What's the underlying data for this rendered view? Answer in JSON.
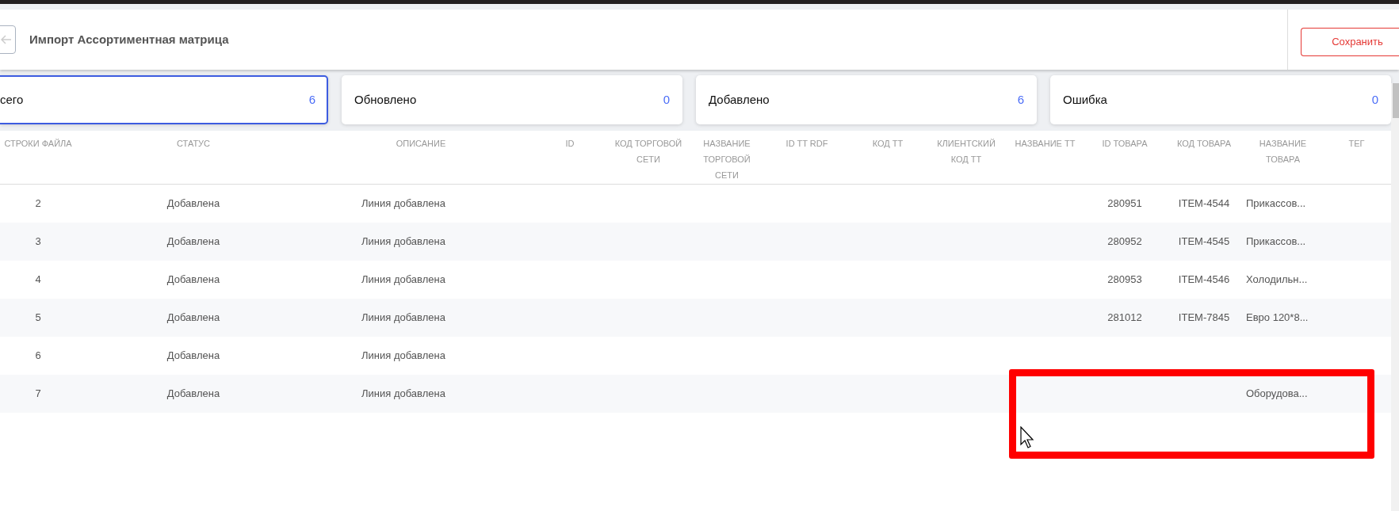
{
  "page": {
    "title": "Импорт Ассортиментная матрица"
  },
  "save_button": "Сохранить",
  "summary_cards": [
    {
      "label": "сего",
      "count": "6",
      "selected": true
    },
    {
      "label": "Обновлено",
      "count": "0",
      "selected": false
    },
    {
      "label": "Добавлено",
      "count": "6",
      "selected": false
    },
    {
      "label": "Ошибка",
      "count": "0",
      "selected": false
    }
  ],
  "table": {
    "columns": [
      "СТРОКИ ФАЙЛА",
      "СТАТУС",
      "ОПИСАНИЕ",
      "ID",
      "КОД ТОРГОВОЙ СЕТИ",
      "НАЗВАНИЕ ТОРГОВОЙ СЕТИ",
      "ID TT RDF",
      "КОД ТТ",
      "КЛИЕНТСКИЙ КОД ТТ",
      "НАЗВАНИЕ ТТ",
      "ID ТОВАРА",
      "КОД ТОВАРА",
      "НАЗВАНИЕ ТОВАРА",
      "ТЕГ"
    ],
    "rows": [
      {
        "row_number": "2",
        "status": "Добавлена",
        "description": "Линия добавлена",
        "product_id": "280951",
        "product_code": "ITEM-4544",
        "product_name": "Прикассов..."
      },
      {
        "row_number": "3",
        "status": "Добавлена",
        "description": "Линия добавлена",
        "product_id": "280952",
        "product_code": "ITEM-4545",
        "product_name": "Прикассов..."
      },
      {
        "row_number": "4",
        "status": "Добавлена",
        "description": "Линия добавлена",
        "product_id": "280953",
        "product_code": "ITEM-4546",
        "product_name": "Холодильн..."
      },
      {
        "row_number": "5",
        "status": "Добавлена",
        "description": "Линия добавлена",
        "product_id": "281012",
        "product_code": "ITEM-7845",
        "product_name": "Евро 120*8..."
      },
      {
        "row_number": "6",
        "status": "Добавлена",
        "description": "Линия добавлена"
      },
      {
        "row_number": "7",
        "status": "Добавлена",
        "description": "Линия добавлена",
        "product_name": "Оборудова..."
      }
    ]
  }
}
